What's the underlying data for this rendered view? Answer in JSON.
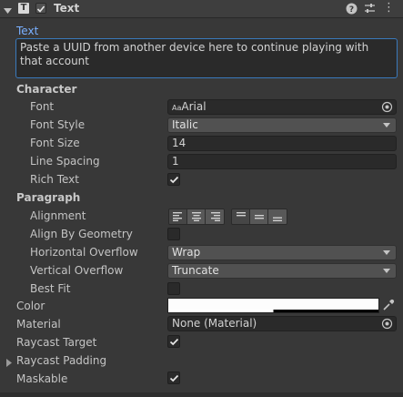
{
  "header": {
    "component_title": "Text",
    "icons": [
      "chevron-down-icon",
      "text-t-icon",
      "checkbox-check-icon",
      "help-icon",
      "preset-icon",
      "more-icon"
    ]
  },
  "text_field": {
    "label": "Text",
    "value": "Paste a UUID from another device here to continue playing with that account"
  },
  "character": {
    "heading": "Character",
    "font_label": "Font",
    "font_icon_text": "Aa",
    "font_value": "Arial",
    "font_style_label": "Font Style",
    "font_style_value": "Italic",
    "font_size_label": "Font Size",
    "font_size_value": "14",
    "line_spacing_label": "Line Spacing",
    "line_spacing_value": "1",
    "rich_text_label": "Rich Text",
    "rich_text_checked": true
  },
  "paragraph": {
    "heading": "Paragraph",
    "alignment_label": "Alignment",
    "horizontal_alignment": [
      "left",
      "center",
      "right"
    ],
    "vertical_alignment": [
      "top",
      "middle",
      "bottom"
    ],
    "align_by_geometry_label": "Align By Geometry",
    "align_by_geometry_checked": false,
    "horizontal_overflow_label": "Horizontal Overflow",
    "horizontal_overflow_value": "Wrap",
    "vertical_overflow_label": "Vertical Overflow",
    "vertical_overflow_value": "Truncate",
    "best_fit_label": "Best Fit",
    "best_fit_checked": false
  },
  "color": {
    "label": "Color",
    "value": "#FDFDFD"
  },
  "material": {
    "label": "Material",
    "value": "None (Material)"
  },
  "raycast_target": {
    "label": "Raycast Target",
    "checked": true
  },
  "raycast_padding": {
    "label": "Raycast Padding"
  },
  "maskable": {
    "label": "Maskable",
    "checked": true
  },
  "colors": {
    "background": "#383838",
    "text_label_accent": "#7ab0ff",
    "field_bg": "#2a2a2a",
    "focus_border": "#3a79bb"
  }
}
